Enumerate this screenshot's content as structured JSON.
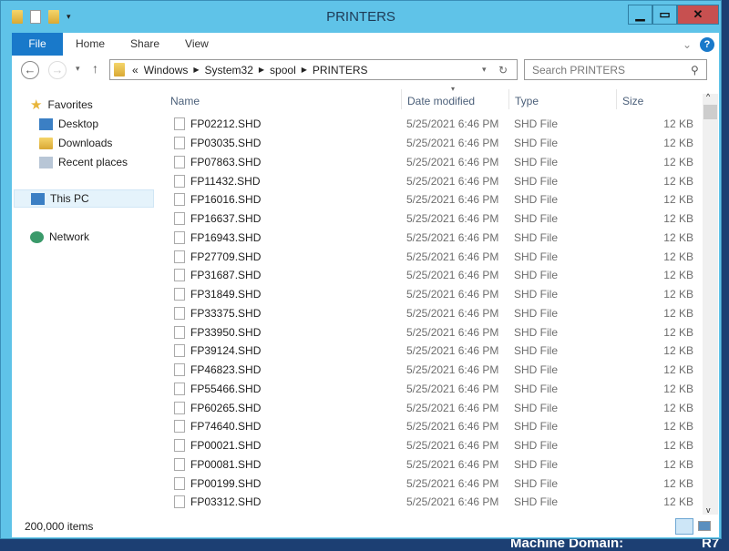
{
  "window": {
    "title": "PRINTERS",
    "accent": "#5fc3e8",
    "file_tab_color": "#1979ca",
    "close_color": "#c75050"
  },
  "ribbon": {
    "tabs": [
      "File",
      "Home",
      "Share",
      "View"
    ]
  },
  "address": {
    "prefix": "«",
    "segments": [
      "Windows",
      "System32",
      "spool",
      "PRINTERS"
    ]
  },
  "search": {
    "placeholder": "Search PRINTERS"
  },
  "nav": {
    "favorites": "Favorites",
    "items": [
      "Desktop",
      "Downloads",
      "Recent places"
    ],
    "this_pc": "This PC",
    "network": "Network"
  },
  "columns": [
    "Name",
    "Date modified",
    "Type",
    "Size"
  ],
  "files": [
    {
      "name": "FP02212.SHD"
    },
    {
      "name": "FP03035.SHD"
    },
    {
      "name": "FP07863.SHD"
    },
    {
      "name": "FP11432.SHD"
    },
    {
      "name": "FP16016.SHD"
    },
    {
      "name": "FP16637.SHD"
    },
    {
      "name": "FP16943.SHD"
    },
    {
      "name": "FP27709.SHD"
    },
    {
      "name": "FP31687.SHD"
    },
    {
      "name": "FP31849.SHD"
    },
    {
      "name": "FP33375.SHD"
    },
    {
      "name": "FP33950.SHD"
    },
    {
      "name": "FP39124.SHD"
    },
    {
      "name": "FP46823.SHD"
    },
    {
      "name": "FP55466.SHD"
    },
    {
      "name": "FP60265.SHD"
    },
    {
      "name": "FP74640.SHD"
    },
    {
      "name": "FP00021.SHD"
    },
    {
      "name": "FP00081.SHD"
    },
    {
      "name": "FP00199.SHD"
    },
    {
      "name": "FP03312.SHD"
    }
  ],
  "file_defaults": {
    "date": "5/25/2021 6:46 PM",
    "type": "SHD File",
    "size": "12 KB"
  },
  "status": {
    "count": "200,000 items"
  },
  "desktop": {
    "text": "Machine Domain:",
    "right": "R7"
  }
}
